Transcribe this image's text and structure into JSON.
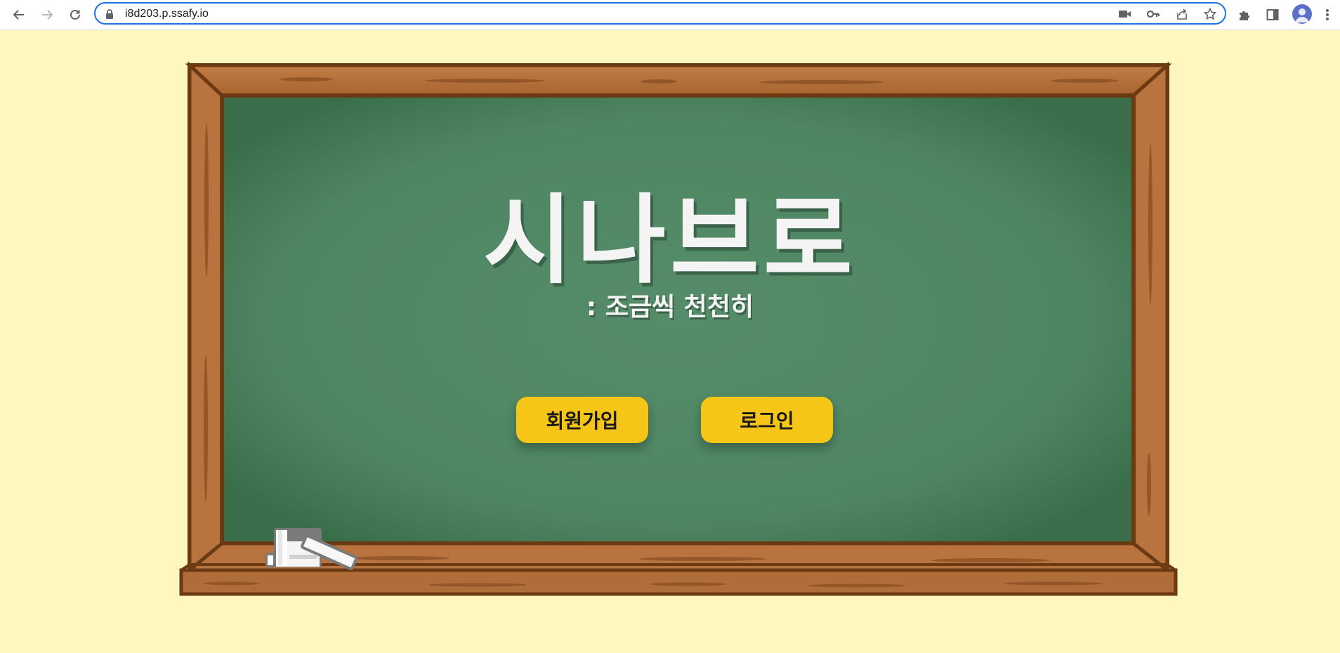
{
  "browser": {
    "url": "i8d203.p.ssafy.io",
    "icons": [
      "back-arrow-icon",
      "forward-arrow-icon",
      "reload-icon",
      "lock-icon",
      "camera-icon",
      "key-icon",
      "share-icon",
      "star-icon",
      "puzzle-icon",
      "side-panel-icon",
      "profile-avatar-icon",
      "kebab-menu-icon"
    ]
  },
  "page": {
    "title": "시나브로",
    "subtitle": ": 조금씩 천천히",
    "signup_label": "회원가입",
    "login_label": "로그인"
  },
  "colors": {
    "background": "#fff7bf",
    "board": "#4f8a64",
    "wood": "#b8733f",
    "wood_dark": "#6b3a12",
    "button": "#f5c518"
  }
}
